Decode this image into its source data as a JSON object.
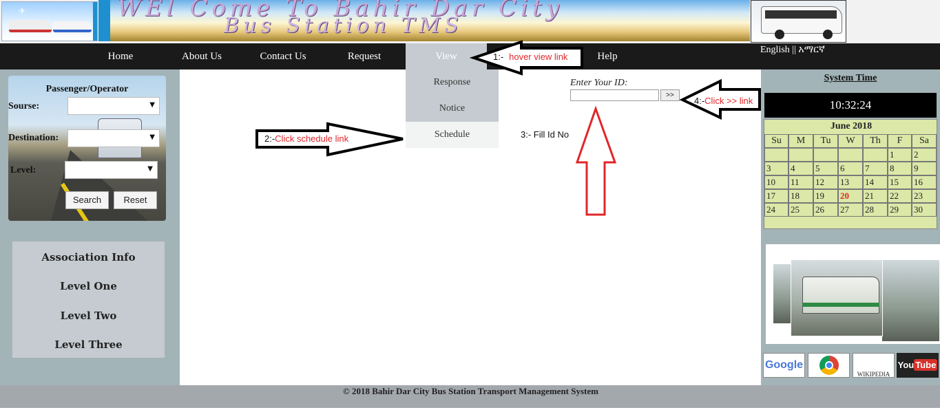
{
  "header": {
    "banner_line1": "WEl Come To Bahir Dar City",
    "banner_line2": "Bus Station TMS"
  },
  "nav": {
    "items": [
      "Home",
      "About Us",
      "Contact Us",
      "Request",
      "View",
      "Help"
    ],
    "language": "English || አማርኛ"
  },
  "dropdown": {
    "items": [
      "Response",
      "Notice",
      "Schedule"
    ]
  },
  "search": {
    "title": "Passenger/Operator",
    "source_label": "Sourse:",
    "destination_label": "Destination:",
    "level_label": "Level:",
    "search_button": "Search",
    "reset_button": "Reset"
  },
  "association": {
    "items": [
      "Association Info",
      "Level One",
      "Level Two",
      "Level Three"
    ]
  },
  "id_form": {
    "label": "Enter Your ID:",
    "input_value": "",
    "submit_label": ">>"
  },
  "annotations": {
    "step1_prefix": "1:-",
    "step1_text": "hover view link",
    "step2_prefix": "2:-",
    "step2_text": "Click schedule link",
    "step3_text": "3:- Fill Id No",
    "step4_prefix": "4:-",
    "step4_text": "Click >> link"
  },
  "system_time": {
    "title": "System Time",
    "clock": "10:32:24"
  },
  "calendar": {
    "title": "June 2018",
    "weekdays": [
      "Su",
      "M",
      "Tu",
      "W",
      "Th",
      "F",
      "Sa"
    ],
    "weeks": [
      [
        "",
        "",
        "",
        "",
        "",
        "1",
        "2"
      ],
      [
        "3",
        "4",
        "5",
        "6",
        "7",
        "8",
        "9"
      ],
      [
        "10",
        "11",
        "12",
        "13",
        "14",
        "15",
        "16"
      ],
      [
        "17",
        "18",
        "19",
        "20",
        "21",
        "22",
        "23"
      ],
      [
        "24",
        "25",
        "26",
        "27",
        "28",
        "29",
        "30"
      ]
    ],
    "today": "20",
    "today_color": "#e0262a"
  },
  "social": {
    "google": "Google",
    "wikipedia": "WIKIPEDIA",
    "youtube_you": "You",
    "youtube_tube": "Tube"
  },
  "footer": {
    "text": "© 2018 Bahir Dar City Bus Station Transport Management System"
  },
  "colors": {
    "nav_bg": "#1a1a1a",
    "side_bg": "#a3b4b8",
    "annotation_red": "#e0262a",
    "calendar_bg": "#dbe8a8"
  }
}
